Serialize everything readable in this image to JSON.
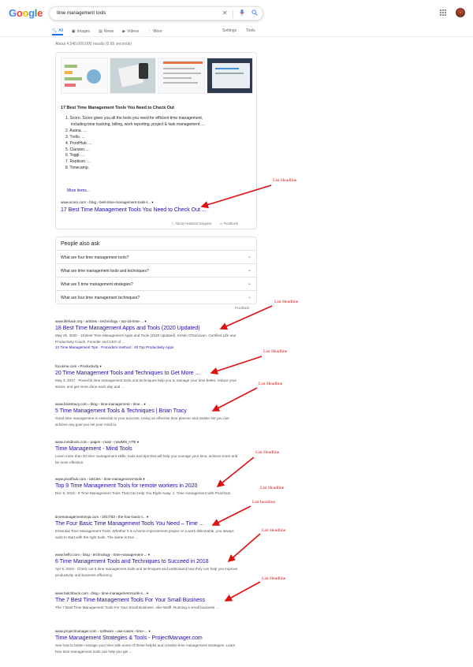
{
  "header": {
    "logo": "Google",
    "query": "time management tools"
  },
  "tabs": [
    {
      "label": "All",
      "icon": "search-icon"
    },
    {
      "label": "Images",
      "icon": "image-icon"
    },
    {
      "label": "News",
      "icon": "news-icon"
    },
    {
      "label": "Videos",
      "icon": "video-icon"
    },
    {
      "label": "More",
      "icon": "more-icon"
    }
  ],
  "tools": {
    "settings": "Settings",
    "tools": "Tools"
  },
  "stats": "About 4,540,000,000 results (0.66 seconds)",
  "featured": {
    "title": "17 Best Time Management Tools You Need to Check Out",
    "item1_line1": "1. Scoro. Scoro gives you all the tools you need for efficient time management,",
    "item1_line2": "including time tracking, billing, work reporting, project & task management. ...",
    "items": [
      "2. Asana. ...",
      "3. Trello. ...",
      "4. ProofHub. ...",
      "5. Clarizen. ...",
      "6. Toggl. ...",
      "7. Replicon. ...",
      "8. Timecamp."
    ],
    "more": "More items...",
    "cite": "www.scoro.com › blog › best-time-management-tools-t...",
    "link": "17 Best Time Management Tools You Need to Check Out ...",
    "about": "About Featured Snippets",
    "feedback": "Feedback"
  },
  "paa": {
    "heading": "People also ask",
    "questions": [
      "What are four time management tools?",
      "What are time management tools and techniques?",
      "What are 5 time management strategies?",
      "What are four time management techniques?"
    ],
    "feedback": "Feedback"
  },
  "results": [
    {
      "cite": "www.lifehack.org › articles › technology › top-15-time-...",
      "title": "18 Best Time Management Apps and Tools (2020 Updated)",
      "desc": "May 26, 2020 - 18 Best Time Management Apps and Tools (2020 Updated). Kirstin O'Donovan. Certified Life and Productivity Coach, Founder and CEO of ...",
      "sitelinks": "10 Time Management Tips · Pomodoro method · 40 Top Productivity Apps"
    },
    {
      "cite": "focusme.com › Productivity",
      "title": "20 Time Management Tools and Techniques to Get More ...",
      "desc": "May 4, 2017 - Powerful time management tools and techniques help you to manage your time better, reduce your stress, and get more done each day and ..."
    },
    {
      "cite": "www.briantracy.com › blog › time-management › time...",
      "title": "5 Time Management Tools & Techniques | Brian Tracy",
      "desc": "Good time management is essential to your success. Using an effective time planner and master list you can achieve any goal you set your mind to."
    },
    {
      "cite": "www.mindtools.com › pages › main › newMN_HTE",
      "title": "Time Management - Mind Tools",
      "desc": "Learn more than 40 time management skills, tools and tips that will help you manage your time, achieve more and be more effective."
    },
    {
      "cite": "www.proofhub.com › articles › time-management-tools",
      "title": "Top 9 Time Management Tools for remote workers in 2020",
      "desc": "Dec 9, 2019 - 9 Time Management Tools That Can Help You Right Away. 1. Time management with ProofHub."
    },
    {
      "cite": "timemanagementninja.com › 2017/03 › the-four-basic-t...",
      "title": "The Four Basic Time Management Tools You Need – Time ...",
      "desc": "Essential Time Management Tools. Whether it is a home-improvement project or a work deliverable, you always want to start with the right tools. The same is true ..."
    },
    {
      "cite": "www.heflo.com › blog › technology › time-management-...",
      "title": "6 Time Management Tools and Techniques to Succeed in 2018",
      "desc": "Apr 9, 2018 - Check out 6 time management tools and techniques and understand how they can help you improve productivity and business efficiency."
    },
    {
      "cite": "www.hatchbuck.com › blog › time-management-tools-s...",
      "title": "The 7 Best Time Management Tools For Your Small Business",
      "desc": "The 7 Best Time Management Tools For Your Small Business. Allie Wolff. Running a small business ..."
    },
    {
      "cite": "www.projectmanager.com › software › use-cases › time-...",
      "title": "Time Management Strategies & Tools - ProjectManager.com",
      "desc": "See how to better manage your time with some of these helpful and creative time management strategies. Learn how time management tools can help you get ..."
    }
  ],
  "annotations": [
    "List Headline",
    "List Headline",
    "List Headline",
    "List Headline",
    "List Headline",
    "List Headline",
    "List headline",
    "List Headline",
    "List Headline"
  ],
  "colors": {
    "link": "#1a0dab",
    "accent": "#1a73e8",
    "annotation": "#e01010"
  }
}
